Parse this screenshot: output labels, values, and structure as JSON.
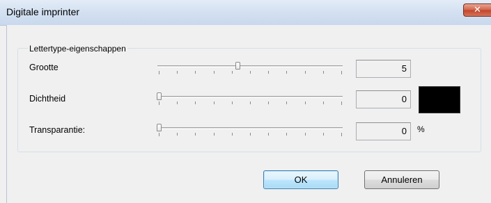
{
  "window": {
    "title": "Digitale imprinter",
    "close_glyph": "✕"
  },
  "group": {
    "legend": "Lettertype-eigenschappen"
  },
  "rows": [
    {
      "label": "Grootte",
      "value": "5",
      "slider_fraction": 0.43
    },
    {
      "label": "Dichtheid",
      "value": "0",
      "slider_fraction": 0.0
    },
    {
      "label": "Transparantie:",
      "value": "0",
      "slider_fraction": 0.0,
      "unit": "%"
    }
  ],
  "color_swatch": "#000000",
  "buttons": {
    "ok": "OK",
    "cancel": "Annuleren"
  }
}
